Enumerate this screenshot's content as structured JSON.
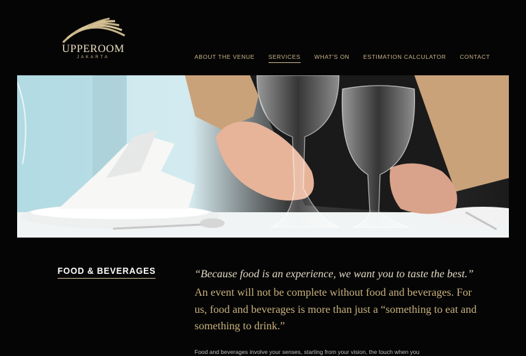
{
  "brand": {
    "name": "UPPEROOM",
    "city": "JAKARTA"
  },
  "nav": {
    "items": [
      {
        "label": "ABOUT THE VENUE",
        "active": false
      },
      {
        "label": "SERVICES",
        "active": true
      },
      {
        "label": "WHAT'S ON",
        "active": false
      },
      {
        "label": "ESTIMATION CALCULATOR",
        "active": false
      },
      {
        "label": "CONTACT",
        "active": false
      }
    ]
  },
  "hero": {
    "image": "waiter-arranging-wine-glasses-photo"
  },
  "section": {
    "title": "FOOD & BEVERAGES",
    "quote": "“Because food is an experience, we want you to taste the best.”",
    "paragraph": "An event will not be complete without food and beverages. For us, food and beverages is more than just a “something to eat and something to drink.”",
    "paragraph2": "Food and beverages involve your senses, starting from your vision, the touch when you"
  },
  "colors": {
    "background": "#050505",
    "gold": "#c9b58a",
    "text_white": "#ffffff"
  }
}
